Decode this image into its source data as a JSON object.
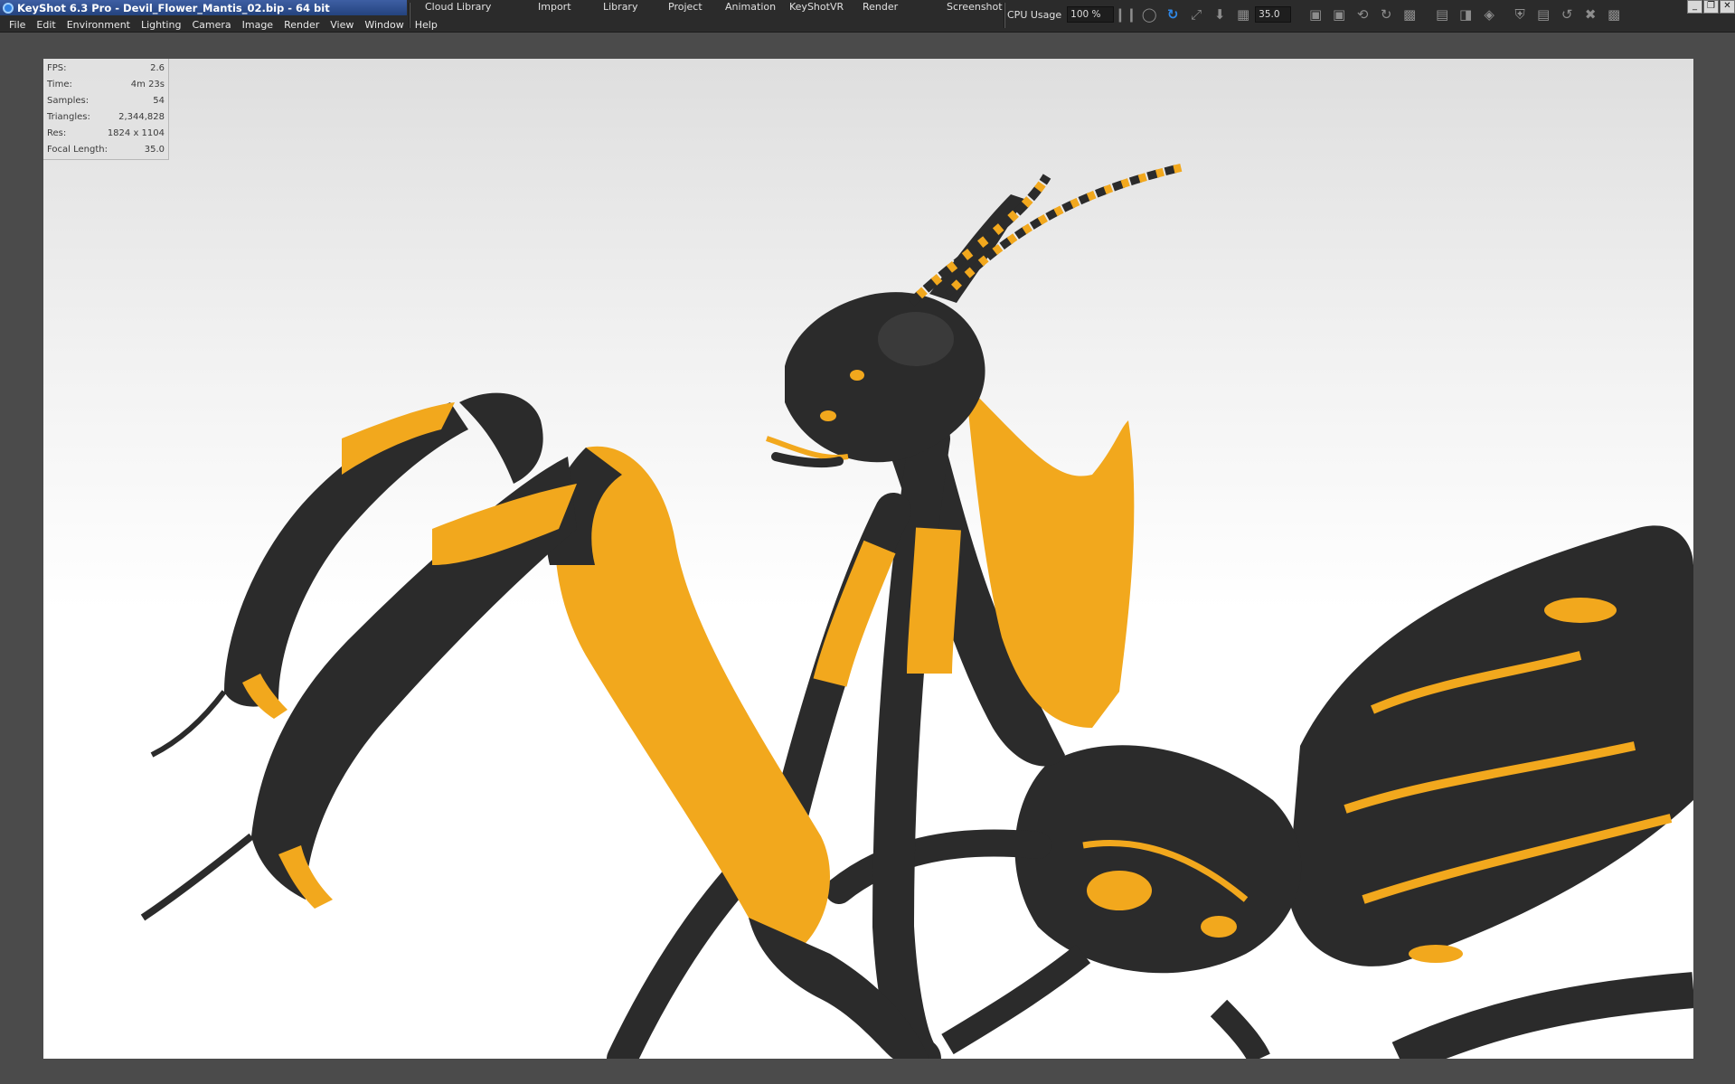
{
  "window": {
    "title": "KeyShot 6.3 Pro  - Devil_Flower_Mantis_02.bip  - 64 bit"
  },
  "menu": [
    "File",
    "Edit",
    "Environment",
    "Lighting",
    "Camera",
    "Image",
    "Render",
    "View",
    "Window",
    "Help"
  ],
  "tabs": [
    "Cloud Library",
    "Import",
    "Library",
    "Project",
    "Animation",
    "KeyShotVR",
    "Render",
    "Screenshot"
  ],
  "toolbar": {
    "cpu_label": "CPU Usage",
    "cpu_value": "100 %",
    "focal_value": "35.0",
    "icons": [
      "pause-icon",
      "pause-rendering-icon",
      "refresh-icon",
      "fit-view-icon",
      "download-icon",
      "region-icon",
      "camera-icon",
      "screenshot-icon",
      "camera-rotate-icon",
      "reset-icon",
      "lock-camera-icon",
      "layers-icon",
      "geometry-icon",
      "material-icon",
      "panel-icon",
      "rotate-icon",
      "expand-icon",
      "presentation-icon"
    ]
  },
  "window_controls": [
    "minimize",
    "restore",
    "close"
  ],
  "stats": [
    {
      "label": "FPS:",
      "value": "2.6"
    },
    {
      "label": "Time:",
      "value": "4m 23s"
    },
    {
      "label": "Samples:",
      "value": "54"
    },
    {
      "label": "Triangles:",
      "value": "2,344,828"
    },
    {
      "label": "Res:",
      "value": "1824 x 1104"
    },
    {
      "label": "Focal Length:",
      "value": "35.0"
    }
  ],
  "colors": {
    "mantis_black": "#2b2b2b",
    "mantis_yellow": "#f2a81d",
    "titlebar": "#2a4a8a"
  }
}
